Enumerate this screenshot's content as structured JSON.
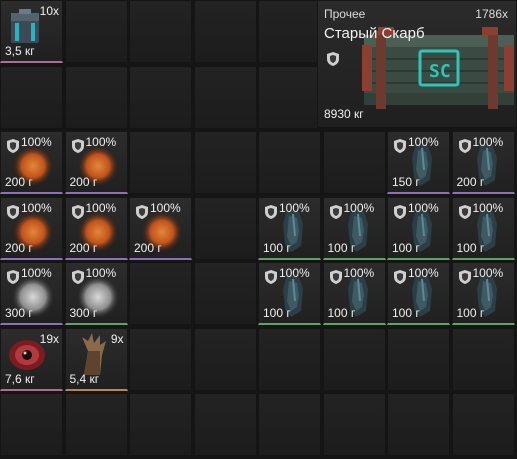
{
  "inventory": {
    "crate_item": {
      "category": "Прочее",
      "count": "1786x",
      "name": "Старый Скарб",
      "weight": "8930 кг",
      "logo": "SC"
    },
    "items": [
      {
        "kind": "container",
        "count": "10x",
        "weight": "3,5 кг",
        "rarity": "pink"
      },
      {
        "kind": "orange-artifact",
        "percent": "100%",
        "weight": "200 г",
        "rarity": "purple"
      },
      {
        "kind": "orange-artifact",
        "percent": "100%",
        "weight": "200 г",
        "rarity": "purple"
      },
      {
        "kind": "blue-armor",
        "percent": "100%",
        "weight": "150 г",
        "rarity": "purple"
      },
      {
        "kind": "blue-armor",
        "percent": "100%",
        "weight": "200 г",
        "rarity": "purple"
      },
      {
        "kind": "orange-artifact",
        "percent": "100%",
        "weight": "200 г",
        "rarity": "purple"
      },
      {
        "kind": "orange-artifact",
        "percent": "100%",
        "weight": "200 г",
        "rarity": "purple"
      },
      {
        "kind": "orange-artifact",
        "percent": "100%",
        "weight": "200 г",
        "rarity": "purple"
      },
      {
        "kind": "blue-armor",
        "percent": "100%",
        "weight": "100 г",
        "rarity": "green"
      },
      {
        "kind": "blue-armor",
        "percent": "100%",
        "weight": "100 г",
        "rarity": "green"
      },
      {
        "kind": "blue-armor",
        "percent": "100%",
        "weight": "100 г",
        "rarity": "green"
      },
      {
        "kind": "blue-armor",
        "percent": "100%",
        "weight": "100 г",
        "rarity": "green"
      },
      {
        "kind": "white-artifact",
        "percent": "100%",
        "weight": "300 г",
        "rarity": "purple"
      },
      {
        "kind": "white-artifact",
        "percent": "100%",
        "weight": "300 г",
        "rarity": "green"
      },
      {
        "kind": "blue-armor",
        "percent": "100%",
        "weight": "100 г",
        "rarity": "green"
      },
      {
        "kind": "blue-armor",
        "percent": "100%",
        "weight": "100 г",
        "rarity": "green"
      },
      {
        "kind": "blue-armor",
        "percent": "100%",
        "weight": "100 г",
        "rarity": "green"
      },
      {
        "kind": "blue-armor",
        "percent": "100%",
        "weight": "100 г",
        "rarity": "green"
      },
      {
        "kind": "eye-part",
        "count": "19x",
        "weight": "7,6 кг",
        "rarity": "pink"
      },
      {
        "kind": "claw-part",
        "count": "9x",
        "weight": "5,4 кг",
        "rarity": "orange"
      }
    ],
    "colors": {
      "slot_bg": "#222222",
      "purple_rarity": "#8e6fb8",
      "green_rarity": "#5fa466",
      "crate_teal": "#2ec4b6"
    }
  }
}
